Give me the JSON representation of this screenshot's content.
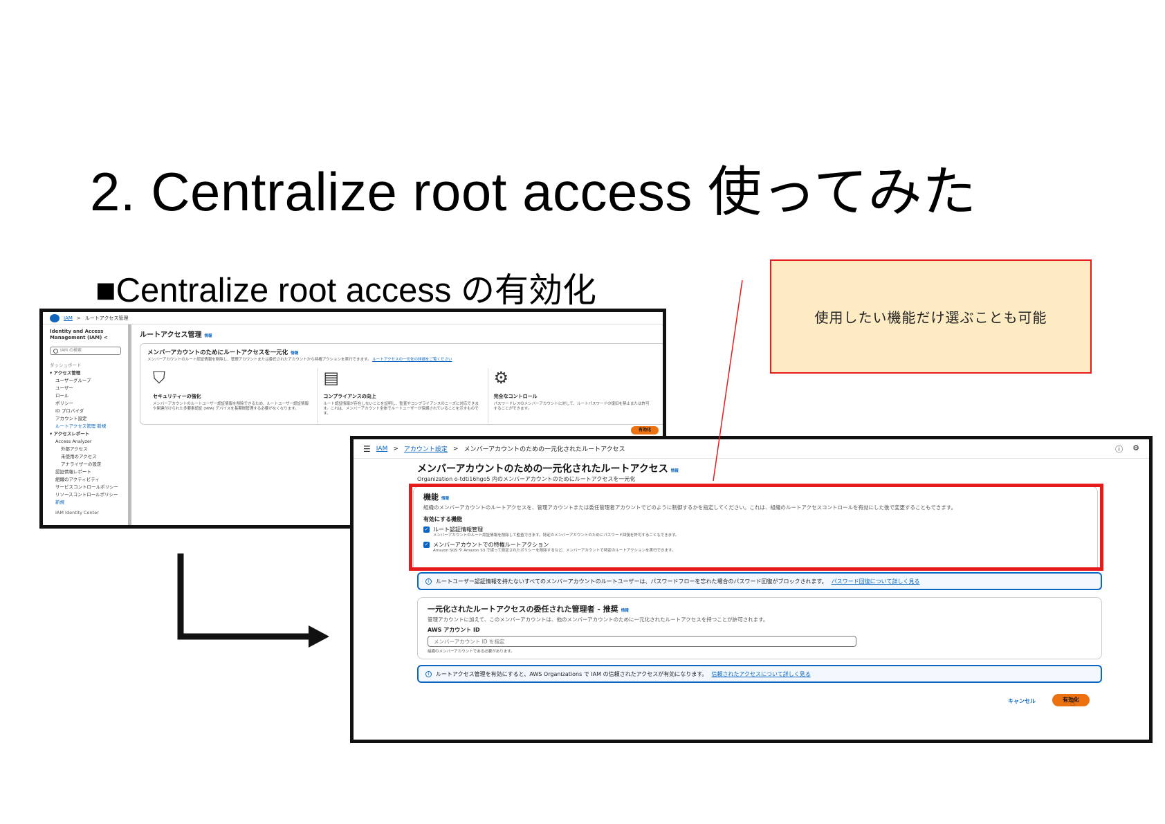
{
  "slide": {
    "title": "2. Centralize root access 使ってみた",
    "subtitle": "■Centralize root access の有効化",
    "callout": "使用したい機能だけ選ぶことも可能"
  },
  "shot1": {
    "breadcrumb_iam": "IAM",
    "breadcrumb_sep": ">",
    "breadcrumb_page": "ルートアクセス管理",
    "sidebar": {
      "title": "Identity and Access Management (IAM)",
      "collapse": "<",
      "search_placeholder": "IAM の検索",
      "dashboard": "ダッシュボード",
      "group_access": "▾ アクセス管理",
      "items_access": [
        "ユーザーグループ",
        "ユーザー",
        "ロール",
        "ポリシー",
        "ID プロバイダ",
        "アカウント設定"
      ],
      "active_item": "ルートアクセス管理",
      "active_badge": "新規",
      "group_reports": "▾ アクセスレポート",
      "analyzer": "Access Analyzer",
      "items_analyzer": [
        "外部アクセス",
        "未使用のアクセス",
        "アナライザーの設定"
      ],
      "items_reports": [
        "認証情報レポート",
        "組織のアクティビティ",
        "サービスコントロールポリシー",
        "リソースコントロールポリシー"
      ],
      "new_badge": "新規",
      "footer": "IAM Identity Center"
    },
    "page_title": "ルートアクセス管理",
    "info": "情報",
    "card_title": "メンバーアカウントのためにルートアクセスを一元化",
    "card_desc": "メンバーアカウントのルート認証情報を削除し、管理アカウントまたは委任されたアカウントから特権アクションを実行できます。",
    "card_link": "ルートアクセスの一元化の詳細をご覧ください",
    "features": [
      {
        "icon": "⛉",
        "title": "セキュリティーの強化",
        "desc": "メンバーアカウントのルートユーザー認証情報を削除できるため、ルートユーザー認証情報や関連付けられた多要素認証 (MFA) デバイスを長期間管理する必要がなくなります。"
      },
      {
        "icon": "▤",
        "title": "コンプライアンスの向上",
        "desc": "ルート認証情報が存在しないことを証明し、監査やコンプライアンスのニーズに対応できます。これは、メンバーアカウント全体でルートユーザーが保護されていることを示すものです。"
      },
      {
        "icon": "⚙",
        "title": "完全なコントロール",
        "desc": "パスワードレスのメンバーアカウントに対して、ルートパスワードの復旧を禁止または許可することができます。"
      }
    ],
    "enable_button": "有効化"
  },
  "shot2": {
    "menu_icon": "☰",
    "crumb_iam": "IAM",
    "crumb_settings": "アカウント設定",
    "crumb_sep": ">",
    "crumb_page": "メンバーアカウントのための一元化されたルートアクセス",
    "top_icons": [
      "ⓘ",
      "⚙"
    ],
    "page_title": "メンバーアカウントのための一元化されたルートアクセス",
    "info": "情報",
    "org_line": "Organization o-tdti16hgo5 内のメンバーアカウントのためにルートアクセスを一元化",
    "feature_title": "機能",
    "feature_desc": "組織のメンバーアカウントのルートアクセスを、管理アカウントまたは委任管理者アカウントでどのように制御するかを指定してください。これは、組織のルートアクセスコントロールを有効にした後で変更することもできます。",
    "enabled_label": "有効にする機能",
    "options": [
      {
        "check": "✓",
        "label": "ルート認証情報管理",
        "desc": "メンバーアカウントのルート認証情報を削除して監査できます。特定のメンバーアカウントのためにパスワード回復を許可することもできます。"
      },
      {
        "check": "✓",
        "label": "メンバーアカウントでの特権ルートアクション",
        "desc": "Amazon SQS や Amazon S3 で誤って設定されたポリシーを削除するなど、メンバーアカウントで特定のルートアクションを実行できます。"
      }
    ],
    "alert1_icon": "i",
    "alert1": "ルートユーザー認証情報を持たないすべてのメンバーアカウントのルートユーザーは、パスワードフローを忘れた場合のパスワード回復がブロックされます。",
    "alert1_link": "パスワード回復について詳しく見る",
    "delegate_title": "一元化されたルートアクセスの委任された管理者 - 推奨",
    "delegate_desc": "管理アカウントに加えて、このメンバーアカウントは、他のメンバーアカウントのために一元化されたルートアクセスを持つことが許可されます。",
    "account_label": "AWS アカウント ID",
    "account_placeholder": "メンバーアカウント ID を指定",
    "account_hint": "組織のメンバーアカウントである必要があります。",
    "alert2_icon": "i",
    "alert2": "ルートアクセス管理を有効にすると、AWS Organizations で IAM の信頼されたアクセスが有効になります。",
    "alert2_link": "信頼されたアクセスについて詳しく見る",
    "cancel_button": "キャンセル",
    "enable_button": "有効化",
    "cursor": "☝"
  },
  "colors": {
    "highlight_red": "#e51b1b",
    "callout_fill": "#fdebc4",
    "aws_orange": "#ec7211",
    "link_blue": "#0a66c2"
  }
}
